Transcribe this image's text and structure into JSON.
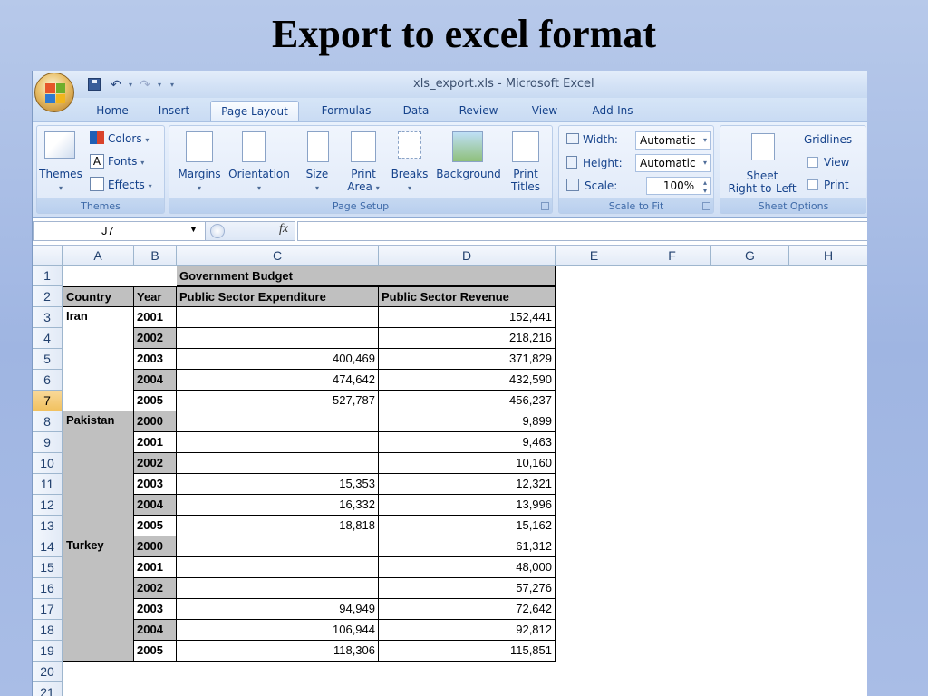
{
  "slide": {
    "title": "Export to excel format"
  },
  "window": {
    "title": "xls_export.xls - Microsoft Excel"
  },
  "tabs": [
    "Home",
    "Insert",
    "Page Layout",
    "Formulas",
    "Data",
    "Review",
    "View",
    "Add-Ins"
  ],
  "active_tab": "Page Layout",
  "ribbon": {
    "themes": {
      "themes_label": "Themes",
      "colors": "Colors",
      "fonts": "Fonts",
      "effects": "Effects",
      "group": "Themes"
    },
    "page_setup": {
      "margins": "Margins",
      "orientation": "Orientation",
      "size": "Size",
      "print_area_1": "Print",
      "print_area_2": "Area",
      "breaks": "Breaks",
      "background": "Background",
      "print_titles_1": "Print",
      "print_titles_2": "Titles",
      "group": "Page Setup"
    },
    "scale_to_fit": {
      "width_label": "Width:",
      "width_value": "Automatic",
      "height_label": "Height:",
      "height_value": "Automatic",
      "scale_label": "Scale:",
      "scale_value": "100%",
      "group": "Scale to Fit"
    },
    "sheet_options": {
      "sheet_1": "Sheet",
      "sheet_2": "Right-to-Left",
      "gridlines": "Gridlines",
      "view": "View",
      "print": "Print",
      "group": "Sheet Options"
    }
  },
  "formula_bar": {
    "name_box": "J7",
    "fx": "fx",
    "content": ""
  },
  "columns": [
    "A",
    "B",
    "C",
    "D",
    "E",
    "F",
    "G",
    "H"
  ],
  "rows": [
    "1",
    "2",
    "3",
    "4",
    "5",
    "6",
    "7",
    "8",
    "9",
    "10",
    "11",
    "12",
    "13",
    "14",
    "15",
    "16",
    "17",
    "18",
    "19",
    "20",
    "21"
  ],
  "selected_row": "7",
  "sheet": {
    "title": "Government Budget",
    "headers": {
      "country": "Country",
      "year": "Year",
      "expenditure": "Public Sector Expenditure",
      "revenue": "Public Sector Revenue"
    },
    "data": [
      {
        "country": "Iran",
        "year": "2001",
        "exp": "",
        "rev": "152,441"
      },
      {
        "country": "",
        "year": "2002",
        "exp": "",
        "rev": "218,216"
      },
      {
        "country": "",
        "year": "2003",
        "exp": "400,469",
        "rev": "371,829"
      },
      {
        "country": "",
        "year": "2004",
        "exp": "474,642",
        "rev": "432,590"
      },
      {
        "country": "",
        "year": "2005",
        "exp": "527,787",
        "rev": "456,237"
      },
      {
        "country": "Pakistan",
        "year": "2000",
        "exp": "",
        "rev": "9,899"
      },
      {
        "country": "",
        "year": "2001",
        "exp": "",
        "rev": "9,463"
      },
      {
        "country": "",
        "year": "2002",
        "exp": "",
        "rev": "10,160"
      },
      {
        "country": "",
        "year": "2003",
        "exp": "15,353",
        "rev": "12,321"
      },
      {
        "country": "",
        "year": "2004",
        "exp": "16,332",
        "rev": "13,996"
      },
      {
        "country": "",
        "year": "2005",
        "exp": "18,818",
        "rev": "15,162"
      },
      {
        "country": "Turkey",
        "year": "2000",
        "exp": "",
        "rev": "61,312"
      },
      {
        "country": "",
        "year": "2001",
        "exp": "",
        "rev": "48,000"
      },
      {
        "country": "",
        "year": "2002",
        "exp": "",
        "rev": "57,276"
      },
      {
        "country": "",
        "year": "2003",
        "exp": "94,949",
        "rev": "72,642"
      },
      {
        "country": "",
        "year": "2004",
        "exp": "106,944",
        "rev": "92,812"
      },
      {
        "country": "",
        "year": "2005",
        "exp": "118,306",
        "rev": "115,851"
      }
    ]
  },
  "colors": {
    "header_gray": "#c0c0c0",
    "ribbon_text": "#15428b",
    "slide_bg": "#a9bde6"
  }
}
